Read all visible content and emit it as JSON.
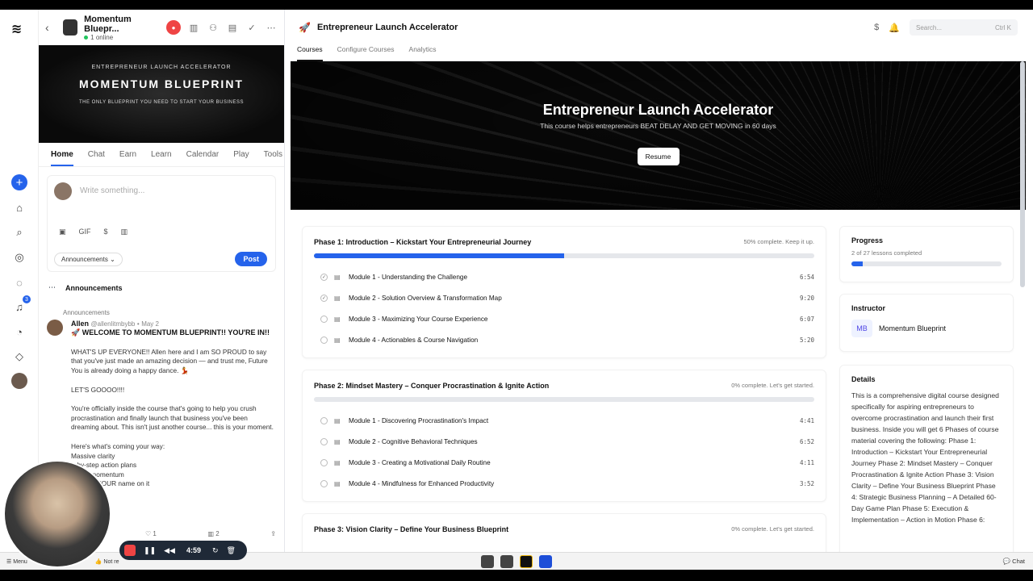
{
  "group": {
    "title": "Momentum Bluepr...",
    "online": "1 online"
  },
  "banner": {
    "kicker": "ENTREPRENEUR LAUNCH ACCELERATOR",
    "title": "MOMENTUM BLUEPRINT",
    "tagline": "THE ONLY BLUEPRINT YOU NEED TO START YOUR BUSINESS"
  },
  "left_tabs": [
    "Home",
    "Chat",
    "Earn",
    "Learn",
    "Calendar",
    "Play",
    "Tools"
  ],
  "composer": {
    "placeholder": "Write something...",
    "gif_label": "GIF",
    "category": "Announcements",
    "post_label": "Post"
  },
  "feed": {
    "section": "Announcements",
    "post": {
      "category": "Announcements",
      "author": "Allen",
      "handle": "@allenlitmbybb",
      "date": "May 2",
      "title": "🚀 WELCOME TO MOMENTUM BLUEPRINT!! YOU'RE IN!!",
      "p1": "WHAT'S UP EVERYONE!! Allen here and I am SO PROUD to say that you've just made an amazing decision — and trust me, Future You is already doing a happy dance. 💃",
      "p2": "LET'S GOOOO!!!!",
      "p3": "You're officially inside the course that's going to help you crush procrastination and finally launch that business you've been dreaming about. This isn't just another course... this is your moment.",
      "p4": "Here's what's coming your way:",
      "b1": "Massive clarity",
      "b2": "p-by-step action plans",
      "b3": "uff, all momentum",
      "b4": "ess with YOUR name on it",
      "likes": "1",
      "views": "2"
    }
  },
  "main": {
    "title": "Entrepreneur Launch Accelerator",
    "search_placeholder": "Search...",
    "search_shortcut": "Ctrl K",
    "tabs": [
      "Courses",
      "Configure Courses",
      "Analytics"
    ]
  },
  "hero": {
    "title": "Entrepreneur Launch Accelerator",
    "subtitle": "This course helps entrepreneurs BEAT DELAY AND GET MOVING in 60 days",
    "resume_label": "Resume"
  },
  "phases": [
    {
      "title": "Phase 1: Introduction – Kickstart Your Entrepreneurial Journey",
      "progress_text": "50% complete. Keep it up.",
      "progress": 0.5,
      "modules": [
        {
          "label": "Module 1 - Understanding the Challenge",
          "duration": "6:54",
          "done": true
        },
        {
          "label": "Module 2 - Solution Overview & Transformation Map",
          "duration": "9:20",
          "done": true
        },
        {
          "label": "Module 3 - Maximizing Your Course Experience",
          "duration": "6:07",
          "done": false
        },
        {
          "label": "Module 4 - Actionables & Course Navigation",
          "duration": "5:20",
          "done": false
        }
      ]
    },
    {
      "title": "Phase 2: Mindset Mastery – Conquer Procrastination & Ignite Action",
      "progress_text": "0% complete. Let's get started.",
      "progress": 0,
      "modules": [
        {
          "label": "Module 1 - Discovering Procrastination's Impact",
          "duration": "4:41",
          "done": false
        },
        {
          "label": "Module 2 - Cognitive Behavioral Techniques",
          "duration": "6:52",
          "done": false
        },
        {
          "label": "Module 3 - Creating a Motivational Daily Routine",
          "duration": "4:11",
          "done": false
        },
        {
          "label": "Module 4 - Mindfulness for Enhanced Productivity",
          "duration": "3:52",
          "done": false
        }
      ]
    },
    {
      "title": "Phase 3: Vision Clarity – Define Your Business Blueprint",
      "progress_text": "0% complete. Let's get started."
    }
  ],
  "progress_card": {
    "title": "Progress",
    "subtitle": "2 of 27 lessons completed",
    "progress": 0.074
  },
  "instructor": {
    "title": "Instructor",
    "initials": "MB",
    "name": "Momentum Blueprint"
  },
  "details": {
    "title": "Details",
    "text": "This is a comprehensive digital course designed specifically for aspiring entrepreneurs to overcome procrastination and launch their first business. Inside you will get 6 Phases of course material covering the following: Phase 1: Introduction – Kickstart Your Entrepreneurial Journey Phase 2: Mindset Mastery – Conquer Procrastination & Ignite Action Phase 3: Vision Clarity – Define Your Business Blueprint Phase 4: Strategic Business Planning – A Detailed 60-Day Game Plan Phase 5: Execution & Implementation – Action in Motion Phase 6:"
  },
  "recorder": {
    "time": "4:59"
  },
  "taskbar": {
    "menu": "Menu",
    "item": "Not re",
    "chat": "Chat"
  }
}
